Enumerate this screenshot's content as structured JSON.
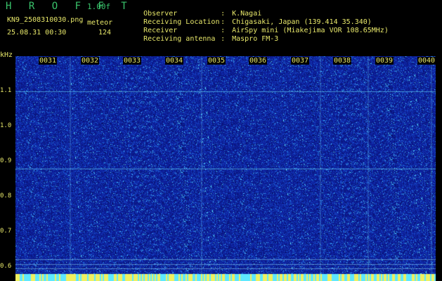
{
  "header": {
    "app_title": "H R O F F T",
    "version": "1.00f",
    "filename": "KN9_2508310030.png",
    "mode": "meteor",
    "timestamp": "25.08.31 00:30",
    "count": "124"
  },
  "meta": [
    {
      "key": "Observer",
      "value": "K.Nagai"
    },
    {
      "key": "Receiving Location",
      "value": "Chigasaki, Japan (139.414 35.340)"
    },
    {
      "key": "Receiver",
      "value": "AirSpy mini (Miakejima VOR 108.65MHz)"
    },
    {
      "key": "Receiving antenna",
      "value": "Maspro FM-3"
    }
  ],
  "axis": {
    "unit": "kHz",
    "y_ticks": [
      "1.1",
      "1.0",
      "0.9",
      "0.8",
      "0.7",
      "0.6"
    ],
    "x_ticks": [
      "0031",
      "0032",
      "0033",
      "0034",
      "0035",
      "0036",
      "0037",
      "0038",
      "0039",
      "0040"
    ]
  },
  "colors": {
    "background": "#0d1f9a",
    "speck": "#4fd6ff",
    "tick_text": "#e8e86a",
    "title": "#39c36b",
    "baseline_band": "#f0f060"
  }
}
